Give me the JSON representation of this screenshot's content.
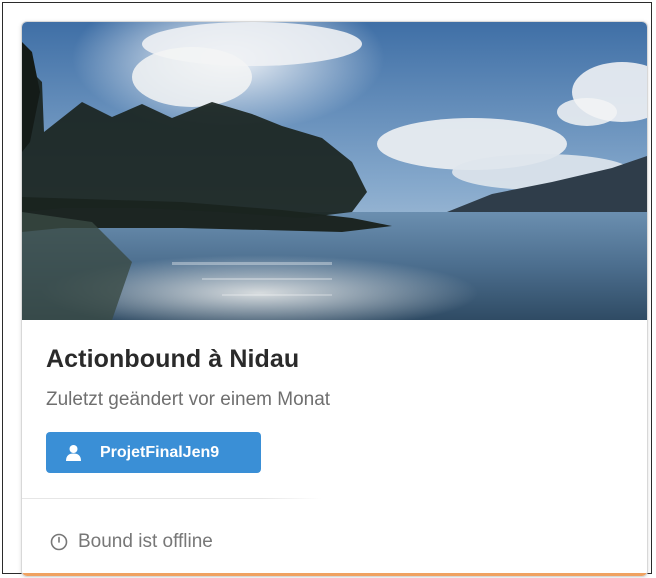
{
  "card": {
    "title": "Actionbound à Nidau",
    "subtitle": "Zuletzt geändert vor einem Monat",
    "user_button": {
      "label": "ProjetFinalJen9",
      "icon": "user-icon",
      "color": "#3a8fd6"
    },
    "status": {
      "icon": "clock-icon",
      "text": "Bound ist offline"
    },
    "image": {
      "description_icon": "lake-landscape-image"
    },
    "accent_color": "#f0a261"
  }
}
